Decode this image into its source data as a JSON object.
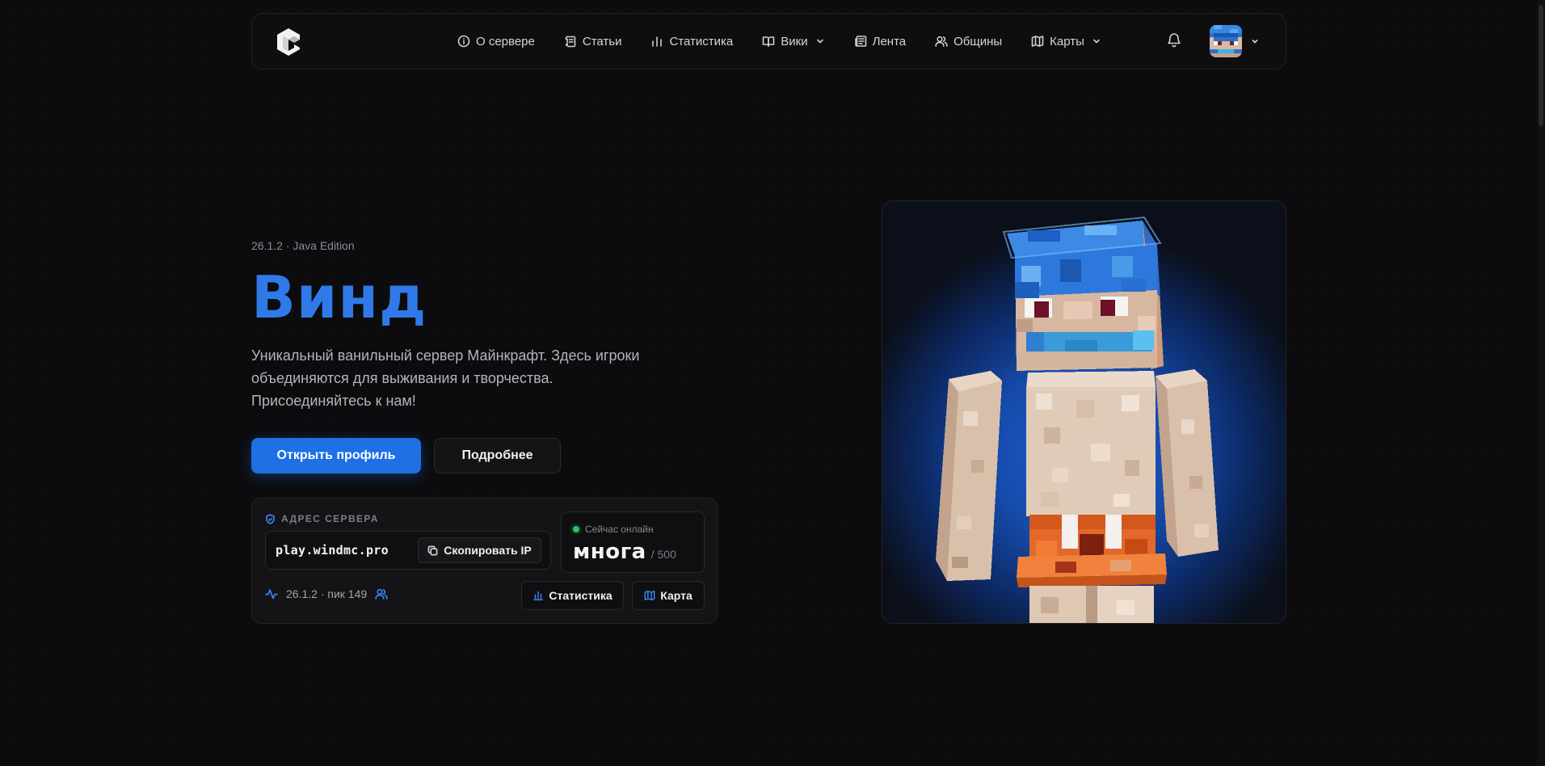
{
  "nav": {
    "items": [
      {
        "label": "О сервере",
        "icon": "info-icon",
        "has_dropdown": false
      },
      {
        "label": "Статьи",
        "icon": "scroll-icon",
        "has_dropdown": false
      },
      {
        "label": "Статистика",
        "icon": "bar-chart-icon",
        "has_dropdown": false
      },
      {
        "label": "Вики",
        "icon": "book-icon",
        "has_dropdown": true
      },
      {
        "label": "Лента",
        "icon": "newspaper-icon",
        "has_dropdown": false
      },
      {
        "label": "Общины",
        "icon": "users-icon",
        "has_dropdown": false
      },
      {
        "label": "Карты",
        "icon": "map-icon",
        "has_dropdown": true
      }
    ]
  },
  "hero": {
    "version_line": "26.1.2 · Java Edition",
    "title": "Винд",
    "description": "Уникальный ванильный сервер Майнкрафт. Здесь игроки объединяются для выживания и творчества. Присоединяйтесь к нам!",
    "primary_button": "Открыть профиль",
    "secondary_button": "Подробнее"
  },
  "server_card": {
    "address_label": "АДРЕС СЕРВЕРА",
    "address": "play.windmc.pro",
    "copy_button": "Скопировать IP",
    "online_label": "Сейчас онлайн",
    "online_count": "многа",
    "online_max": "/ 500",
    "meta": "26.1.2 · пик 149",
    "stats_button": "Статистика",
    "map_button": "Карта"
  },
  "colors": {
    "accent": "#1f6fe5",
    "title": "#2f7ae8",
    "online_dot": "#22c55e",
    "background": "#0c0c0e"
  }
}
